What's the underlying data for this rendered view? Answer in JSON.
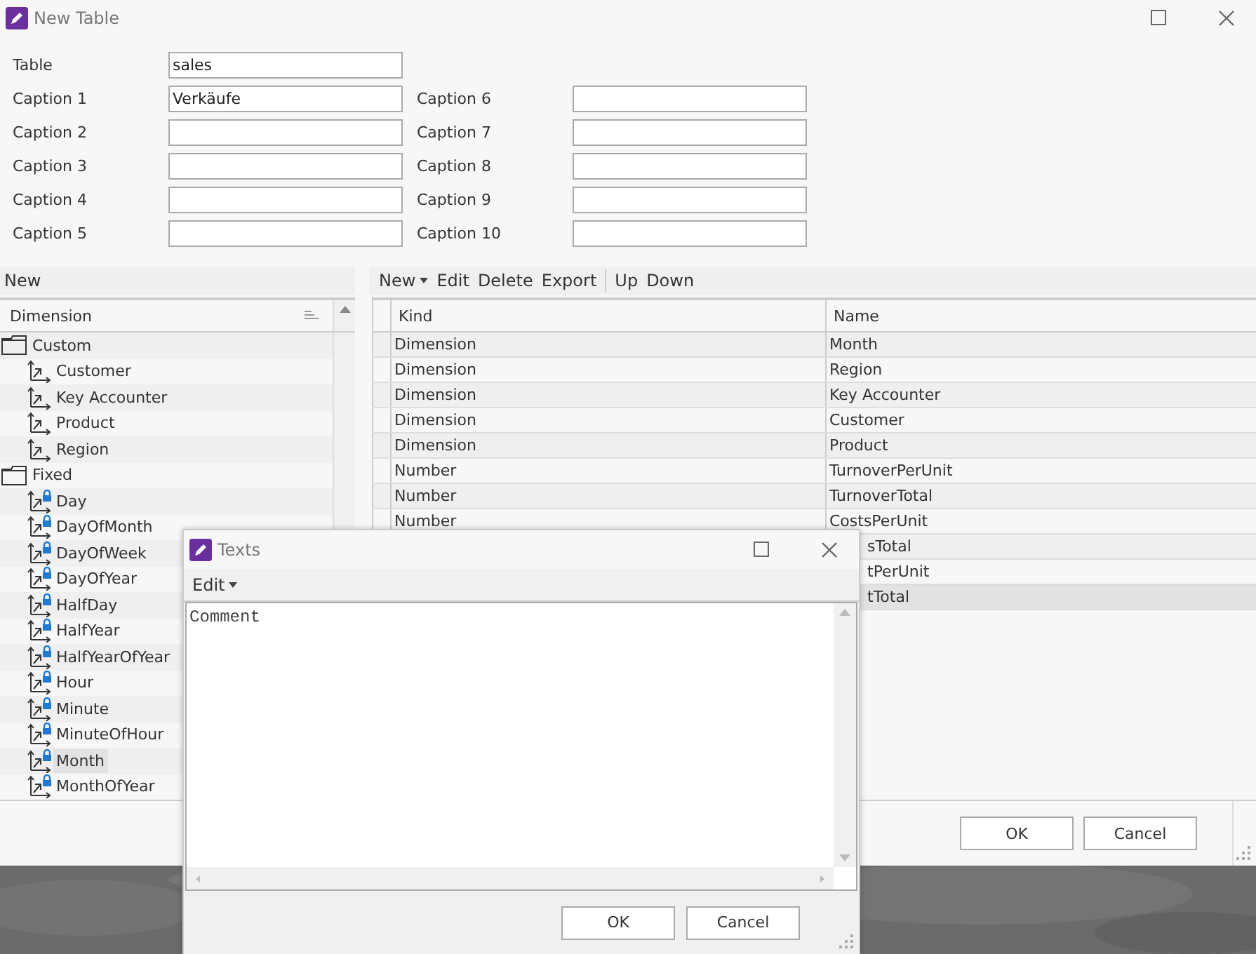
{
  "window": {
    "title": "New Table"
  },
  "form": {
    "table": {
      "label": "Table",
      "value": "sales"
    },
    "captions": [
      {
        "label": "Caption 1",
        "value": "Verkäufe"
      },
      {
        "label": "Caption 2"
      },
      {
        "label": "Caption 3"
      },
      {
        "label": "Caption 4"
      },
      {
        "label": "Caption 5"
      },
      {
        "label": "Caption 6"
      },
      {
        "label": "Caption 7"
      },
      {
        "label": "Caption 8"
      },
      {
        "label": "Caption 9"
      },
      {
        "label": "Caption 10"
      }
    ]
  },
  "left_panel": {
    "header": "New",
    "column": "Dimension",
    "tree": [
      {
        "label": "Custom",
        "kind": "folder",
        "selected": false,
        "children": [
          {
            "label": "Customer",
            "kind": "dimension",
            "locked": false,
            "selected": false
          },
          {
            "label": "Key Accounter",
            "kind": "dimension",
            "locked": false,
            "selected": false
          },
          {
            "label": "Product",
            "kind": "dimension",
            "locked": false,
            "selected": false
          },
          {
            "label": "Region",
            "kind": "dimension",
            "locked": false,
            "selected": false
          }
        ]
      },
      {
        "label": "Fixed",
        "kind": "folder",
        "selected": false,
        "children": [
          {
            "label": "Day",
            "kind": "dimension",
            "locked": true,
            "selected": false
          },
          {
            "label": "DayOfMonth",
            "kind": "dimension",
            "locked": true,
            "selected": false
          },
          {
            "label": "DayOfWeek",
            "kind": "dimension",
            "locked": true,
            "selected": false
          },
          {
            "label": "DayOfYear",
            "kind": "dimension",
            "locked": true,
            "selected": false
          },
          {
            "label": "HalfDay",
            "kind": "dimension",
            "locked": true,
            "selected": false
          },
          {
            "label": "HalfYear",
            "kind": "dimension",
            "locked": true,
            "selected": false
          },
          {
            "label": "HalfYearOfYear",
            "kind": "dimension",
            "locked": true,
            "selected": false
          },
          {
            "label": "Hour",
            "kind": "dimension",
            "locked": true,
            "selected": false
          },
          {
            "label": "Minute",
            "kind": "dimension",
            "locked": true,
            "selected": false
          },
          {
            "label": "MinuteOfHour",
            "kind": "dimension",
            "locked": true,
            "selected": false
          },
          {
            "label": "Month",
            "kind": "dimension",
            "locked": true,
            "selected": true
          },
          {
            "label": "MonthOfYear",
            "kind": "dimension",
            "locked": true,
            "selected": false
          }
        ]
      }
    ]
  },
  "toolbar": [
    [
      {
        "label": "New",
        "dropdown": true
      },
      {
        "label": "Edit",
        "dropdown": false
      },
      {
        "label": "Delete",
        "dropdown": false
      },
      {
        "label": "Export",
        "dropdown": false
      }
    ],
    [
      {
        "label": "Up",
        "dropdown": false
      },
      {
        "label": "Down",
        "dropdown": false
      }
    ]
  ],
  "grid": {
    "columns": [
      "Kind",
      "Name"
    ],
    "rows": [
      {
        "kind_cell": "Dimension",
        "name_cell": "Month",
        "selected": false
      },
      {
        "kind_cell": "Dimension",
        "name_cell": "Region",
        "selected": false
      },
      {
        "kind_cell": "Dimension",
        "name_cell": "Key Accounter",
        "selected": false
      },
      {
        "kind_cell": "Dimension",
        "name_cell": "Customer",
        "selected": false
      },
      {
        "kind_cell": "Dimension",
        "name_cell": "Product",
        "selected": false
      },
      {
        "kind_cell": "Number",
        "name_cell": "TurnoverPerUnit",
        "selected": false
      },
      {
        "kind_cell": "Number",
        "name_cell": "TurnoverTotal",
        "selected": false
      },
      {
        "kind_cell": "Number",
        "name_cell": "CostsPerUnit",
        "selected": false
      },
      {
        "name_cell": "sTotal",
        "selected": false
      },
      {
        "name_cell": "tPerUnit",
        "selected": false
      },
      {
        "name_cell": "tTotal",
        "selected": true
      }
    ]
  },
  "buttons": [
    "OK",
    "Cancel"
  ],
  "texts_dialog": {
    "title": "Texts",
    "menu": [
      {
        "label": "Edit",
        "dropdown": true
      }
    ],
    "text": "Comment",
    "buttons": [
      "OK",
      "Cancel"
    ]
  }
}
